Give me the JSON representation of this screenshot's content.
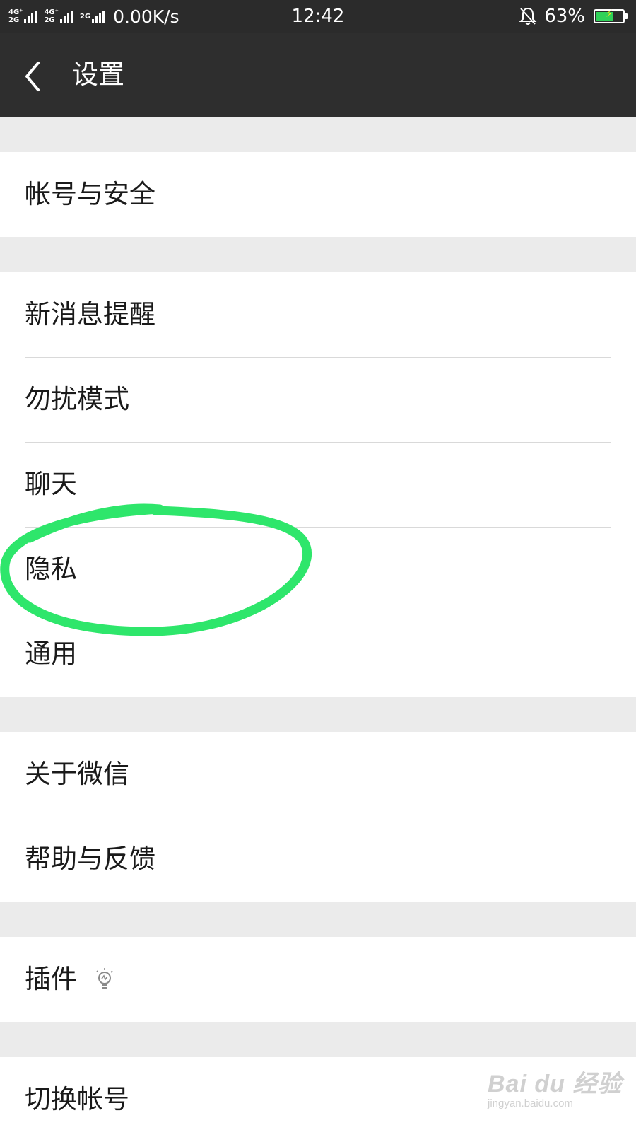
{
  "status_bar": {
    "network_1": [
      "4G⁺",
      "2G"
    ],
    "network_2": [
      "4G⁺",
      "2G"
    ],
    "network_3": "2G",
    "speed": "0.00K/s",
    "time": "12:42",
    "battery_percent": "63%",
    "battery_level": 0.63,
    "battery_color": "#2fd158"
  },
  "app_bar": {
    "back_icon": "chevron-left-icon",
    "title": "设置"
  },
  "settings": {
    "group1": [
      "帐号与安全"
    ],
    "group2": [
      "新消息提醒",
      "勿扰模式",
      "聊天",
      "隐私",
      "通用"
    ],
    "group3": [
      "关于微信",
      "帮助与反馈"
    ],
    "group4": {
      "label": "插件",
      "icon": "lightbulb-icon"
    },
    "group5": [
      "切换帐号"
    ]
  },
  "annotation": {
    "target": "隐私",
    "shape": "hand-drawn-circle",
    "color": "#2ee66b"
  },
  "watermark": {
    "main": "Bai du 经验",
    "sub": "jingyan.baidu.com"
  }
}
